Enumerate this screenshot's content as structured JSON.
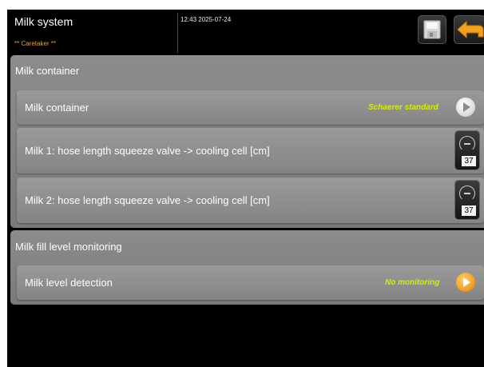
{
  "header": {
    "title": "Milk system",
    "role": "** Caretaker **",
    "datetime": "12:43 2025-07-24",
    "save_icon": "save-disk-icon",
    "back_icon": "back-arrow-icon",
    "accent_color": "#f0a020"
  },
  "sections": [
    {
      "heading": "Milk container",
      "rows": [
        {
          "label": "Milk container",
          "value": "Schaerer standard",
          "icon": "play-icon"
        },
        {
          "label": "Milk 1: hose length squeeze valve -> cooling cell [cm]",
          "value": "37",
          "icon": "gauge-icon"
        },
        {
          "label": "Milk 2: hose length squeeze valve -> cooling cell [cm]",
          "value": "37",
          "icon": "gauge-icon"
        }
      ]
    },
    {
      "heading": "Milk fill level monitoring",
      "rows": [
        {
          "label": "Milk level detection",
          "value": "No monitoring",
          "icon": "play-icon"
        }
      ]
    }
  ],
  "colors": {
    "value_text": "#d6ef00",
    "section_bg": "#888888",
    "screen_bg": "#000000"
  }
}
